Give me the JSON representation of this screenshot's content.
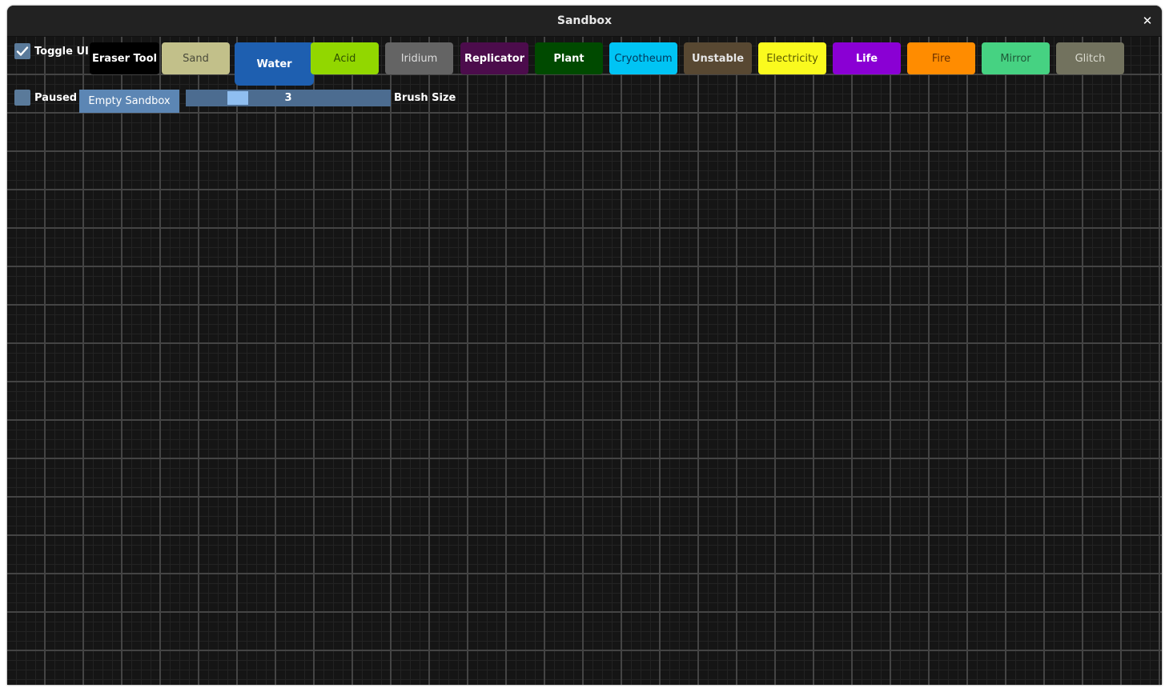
{
  "window": {
    "title": "Sandbox",
    "close_glyph": "✕"
  },
  "controls": {
    "toggle_ui": {
      "label": "Toggle UI",
      "checked": true
    },
    "paused": {
      "label": "Paused",
      "checked": false
    },
    "empty_sandbox_label": "Empty Sandbox",
    "brush": {
      "value": "3",
      "label": "Brush Size",
      "min": 1,
      "max": 10
    }
  },
  "elements": [
    {
      "label": "Eraser Tool",
      "bg": "#000000",
      "fg": "#ffffff",
      "bold": true,
      "selected": false
    },
    {
      "label": "Sand",
      "bg": "#c2c08a",
      "fg": "#4a4a3a",
      "bold": false,
      "selected": false
    },
    {
      "label": "Water",
      "bg": "#1e5fb0",
      "fg": "#ffffff",
      "bold": true,
      "selected": true
    },
    {
      "label": "Acid",
      "bg": "#92d700",
      "fg": "#2f5000",
      "bold": false,
      "selected": false
    },
    {
      "label": "Iridium",
      "bg": "#646464",
      "fg": "#dddddd",
      "bold": false,
      "selected": false
    },
    {
      "label": "Replicator",
      "bg": "#4c0c4c",
      "fg": "#ffffff",
      "bold": true,
      "selected": false
    },
    {
      "label": "Plant",
      "bg": "#004a00",
      "fg": "#ffffff",
      "bold": true,
      "selected": false
    },
    {
      "label": "Cryotheum",
      "bg": "#00c4f4",
      "fg": "#00365a",
      "bold": false,
      "selected": false
    },
    {
      "label": "Unstable",
      "bg": "#584832",
      "fg": "#e6e6e6",
      "bold": true,
      "selected": false
    },
    {
      "label": "Electricity",
      "bg": "#fafa1e",
      "fg": "#5a5a00",
      "bold": false,
      "selected": false
    },
    {
      "label": "Life",
      "bg": "#8a00d4",
      "fg": "#ffffff",
      "bold": true,
      "selected": false
    },
    {
      "label": "Fire",
      "bg": "#ff8c00",
      "fg": "#6a3000",
      "bold": false,
      "selected": false
    },
    {
      "label": "Mirror",
      "bg": "#46d282",
      "fg": "#1e5a38",
      "bold": false,
      "selected": false
    },
    {
      "label": "Glitch",
      "bg": "#72725e",
      "fg": "#dcdcd0",
      "bold": false,
      "selected": false
    }
  ]
}
